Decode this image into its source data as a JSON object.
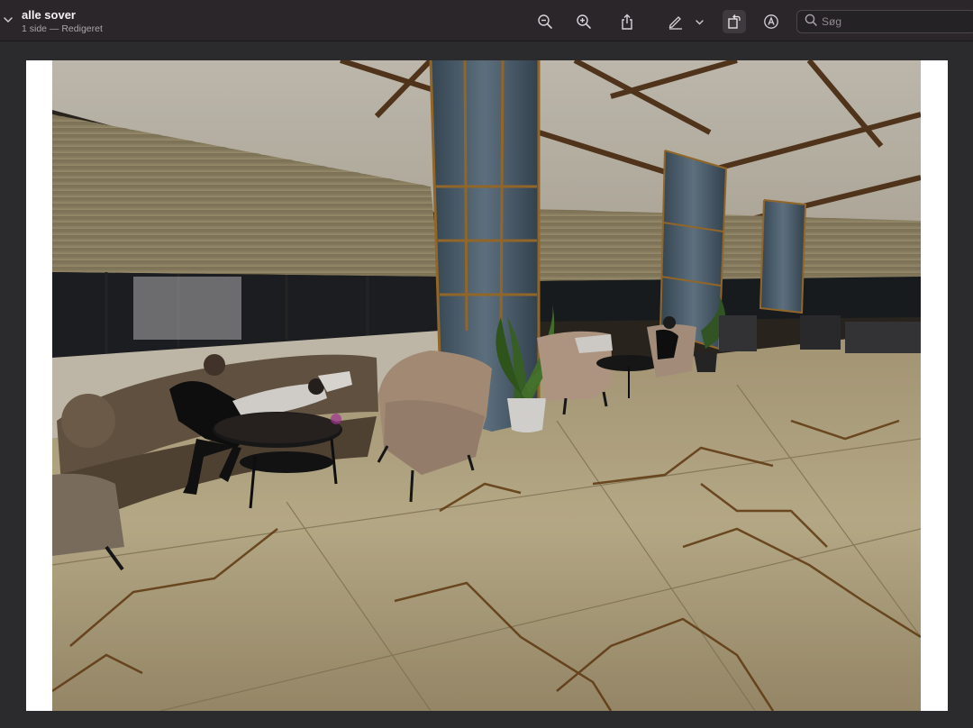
{
  "window": {
    "title": "alle sover",
    "subtitle": "1 side — Redigeret"
  },
  "toolbar": {
    "buttons": [
      {
        "name": "zoom-out-icon"
      },
      {
        "name": "zoom-in-icon"
      },
      {
        "name": "share-icon"
      },
      {
        "name": "markup-pen-icon"
      },
      {
        "name": "chevron-down-icon"
      },
      {
        "name": "rotate-icon"
      },
      {
        "name": "annotate-icon"
      }
    ],
    "rotate_active": true
  },
  "search": {
    "placeholder": "Søg"
  },
  "colors": {
    "toolbar_bg": "#2a2629",
    "canvas_bg": "#2b2a2c",
    "page_bg": "#ffffff"
  }
}
